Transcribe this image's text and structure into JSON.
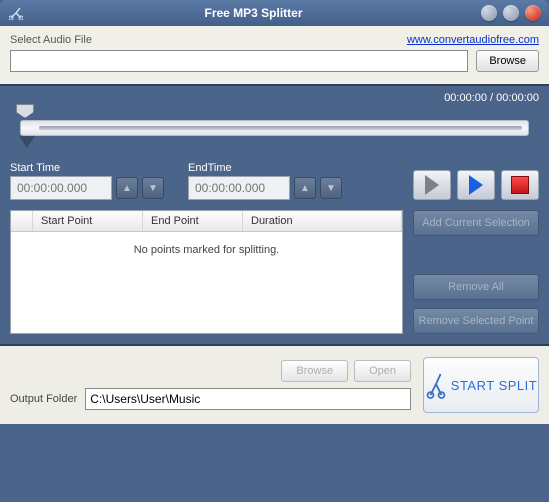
{
  "title": "Free MP3 Splitter",
  "file_section": {
    "label": "Select Audio File",
    "link_text": "www.convertaudiofree.com",
    "path_value": "",
    "browse_label": "Browse"
  },
  "playback": {
    "time_readout": "00:00:00 / 00:00:00"
  },
  "start_time": {
    "label": "Start Time",
    "placeholder": "00:00:00.000"
  },
  "end_time": {
    "label": "EndTime",
    "placeholder": "00:00:00.000"
  },
  "list": {
    "col_start": "Start Point",
    "col_end": "End Point",
    "col_duration": "Duration",
    "empty_message": "No points marked for splitting."
  },
  "side_buttons": {
    "add": "Add Current Selection",
    "remove_all": "Remove All",
    "remove_selected": "Remove Selected Point"
  },
  "footer": {
    "browse": "Browse",
    "open": "Open",
    "output_label": "Output Folder",
    "output_value": "C:\\Users\\User\\Music",
    "start_split": "START SPLIT"
  }
}
